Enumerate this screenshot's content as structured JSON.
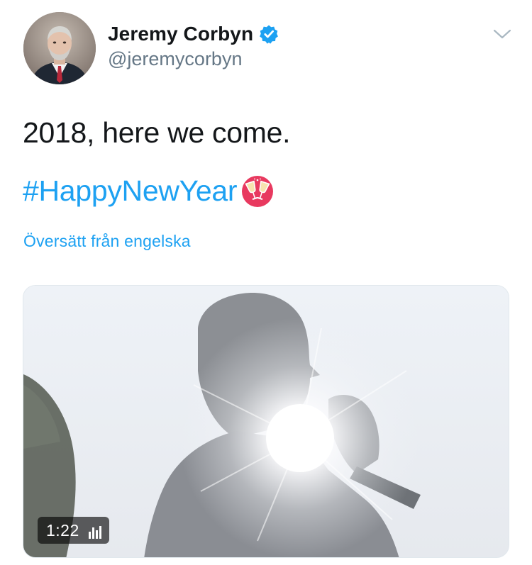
{
  "author": {
    "display_name": "Jeremy Corbyn",
    "handle": "@jeremycorbyn",
    "verified": true,
    "avatar_icon": "profile-photo"
  },
  "tweet": {
    "text": "2018, here we come.",
    "hashtag": "#HappyNewYear",
    "emoji": "clinking-glasses"
  },
  "translate_link": "Översätt från engelska",
  "media": {
    "type": "video",
    "duration": "1:22",
    "views_icon": "bar-chart-icon"
  },
  "colors": {
    "accent": "#1da1f2",
    "text": "#14171a",
    "secondary": "#657786"
  }
}
